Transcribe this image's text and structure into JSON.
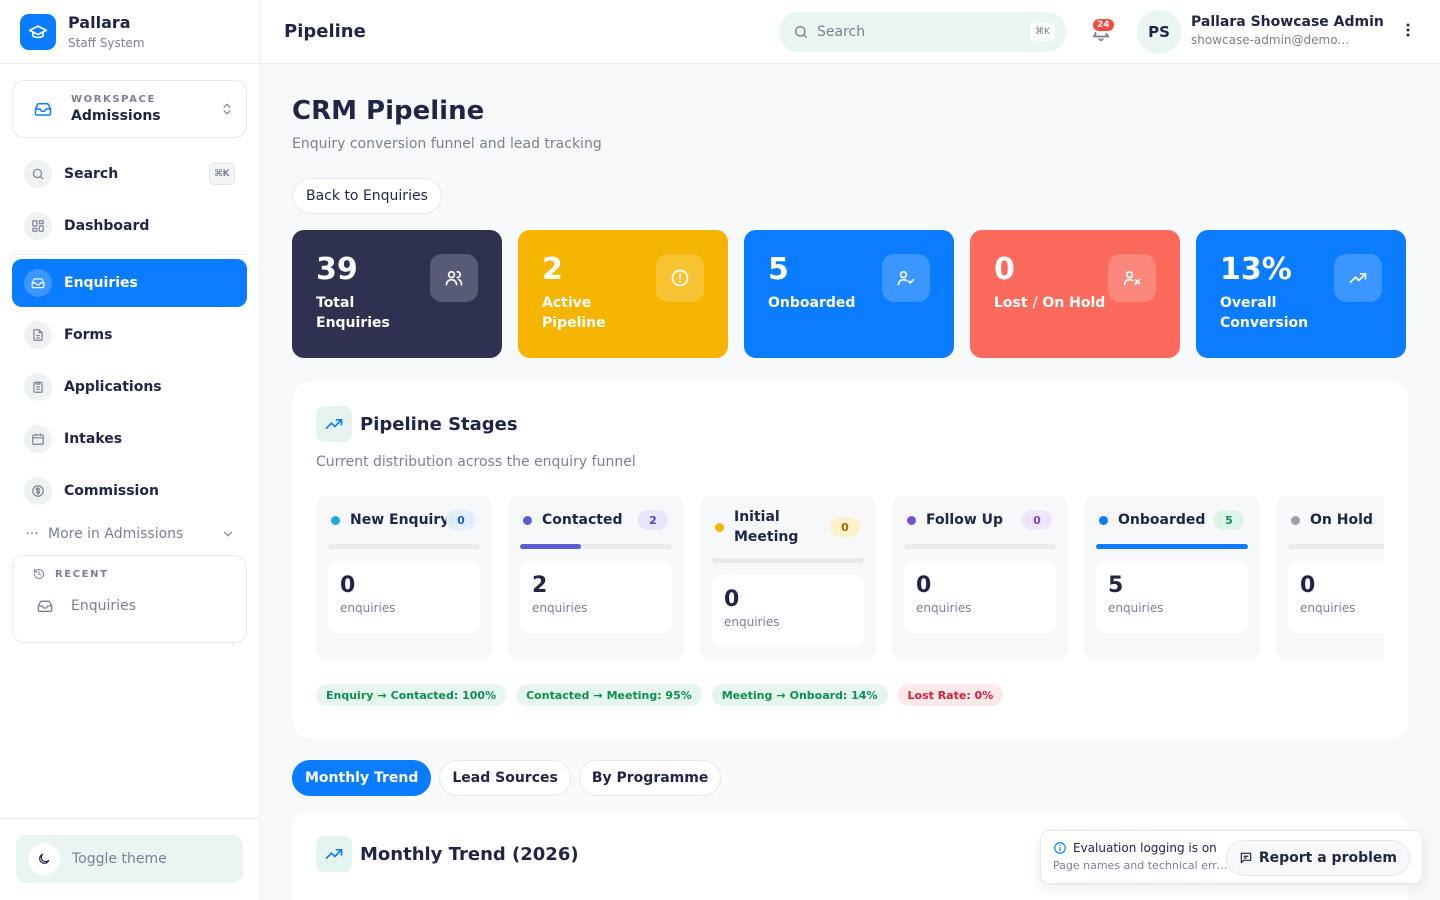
{
  "brand": {
    "name": "Pallara",
    "subtitle": "Staff System",
    "logo_icon": "graduation-cap-icon"
  },
  "workspace": {
    "label": "WORKSPACE",
    "value": "Admissions"
  },
  "nav": {
    "search": {
      "label": "Search",
      "shortcut": "⌘K"
    },
    "dashboard": {
      "label": "Dashboard"
    },
    "items": [
      {
        "label": "Enquiries",
        "icon": "inbox-icon",
        "active": true
      },
      {
        "label": "Forms",
        "icon": "document-icon"
      },
      {
        "label": "Applications",
        "icon": "clipboard-icon"
      },
      {
        "label": "Intakes",
        "icon": "calendar-icon"
      },
      {
        "label": "Commission",
        "icon": "dollar-icon"
      }
    ],
    "more": "More in Admissions"
  },
  "recent": {
    "title": "RECENT",
    "item": "Enquiries"
  },
  "theme_toggle": "Toggle theme",
  "topbar": {
    "title": "Pipeline",
    "search_placeholder": "Search",
    "search_shortcut": "⌘K",
    "notifications": "24",
    "avatar": "PS",
    "user_name": "Pallara Showcase Admin",
    "user_email": "showcase-admin@demo.pallara.com"
  },
  "page": {
    "title": "CRM Pipeline",
    "subtitle": "Enquiry conversion funnel and lead tracking",
    "back_button": "Back to Enquiries"
  },
  "stats": [
    {
      "value": "39",
      "label": "Total Enquiries",
      "color": "#2e3250",
      "icon": "users-icon"
    },
    {
      "value": "2",
      "label": "Active Pipeline",
      "color": "#f5b400",
      "icon": "alert-circle-icon"
    },
    {
      "value": "5",
      "label": "Onboarded",
      "color": "#0a7cff",
      "icon": "user-check-icon"
    },
    {
      "value": "0",
      "label": "Lost / On Hold",
      "color": "#fc6a5b",
      "icon": "user-x-icon"
    },
    {
      "value": "13%",
      "label": "Overall Conversion",
      "color": "#0a7cff",
      "icon": "trending-up-icon"
    }
  ],
  "pipeline": {
    "title": "Pipeline Stages",
    "subtitle": "Current distribution across the enquiry funnel",
    "unit": "enquiries",
    "stages": [
      {
        "name": "New Enquiry",
        "count": "0",
        "value": "0",
        "share": 0,
        "dot": "#1ea7e0",
        "badge_bg": "#e3eefe",
        "badge_fg": "#1d5fd6",
        "bar": "#1ea7e0"
      },
      {
        "name": "Contacted",
        "count": "2",
        "value": "2",
        "share": 0.4,
        "dot": "#5b5bd6",
        "badge_bg": "#e7e6fb",
        "badge_fg": "#4b45c2",
        "bar": "#5b5bd6"
      },
      {
        "name": "Initial Meeting",
        "count": "0",
        "value": "0",
        "share": 0,
        "dot": "#f5b400",
        "badge_bg": "#fdf1cc",
        "badge_fg": "#a16a00",
        "bar": "#f5b400"
      },
      {
        "name": "Follow Up",
        "count": "0",
        "value": "0",
        "share": 0,
        "dot": "#7b4fd3",
        "badge_bg": "#efe6fb",
        "badge_fg": "#7b3fcc",
        "bar": "#7b4fd3"
      },
      {
        "name": "Onboarded",
        "count": "5",
        "value": "5",
        "share": 1,
        "dot": "#0a7cff",
        "badge_bg": "#dcf5e7",
        "badge_fg": "#0b8f55",
        "bar": "#0a7cff"
      },
      {
        "name": "On Hold",
        "count": "0",
        "value": "0",
        "share": 0,
        "dot": "#9aa0ab",
        "badge_bg": "#eceef2",
        "badge_fg": "#5b6170",
        "bar": "#9aa0ab"
      }
    ],
    "rates": [
      {
        "from": "Enquiry",
        "to": "Contacted: 100%",
        "type": "green"
      },
      {
        "from": "Contacted",
        "to": "Meeting: 95%",
        "type": "green"
      },
      {
        "from": "Meeting",
        "to": "Onboard: 14%",
        "type": "green"
      },
      {
        "label": "Lost Rate: 0%",
        "type": "red"
      }
    ]
  },
  "tabs": [
    {
      "label": "Monthly Trend",
      "active": true
    },
    {
      "label": "Lead Sources"
    },
    {
      "label": "By Programme"
    }
  ],
  "trend": {
    "title": "Monthly Trend (2026)"
  },
  "toast": {
    "title": "Evaluation logging is on",
    "subtitle": "Page names and technical errors are logged",
    "button": "Report a problem"
  }
}
